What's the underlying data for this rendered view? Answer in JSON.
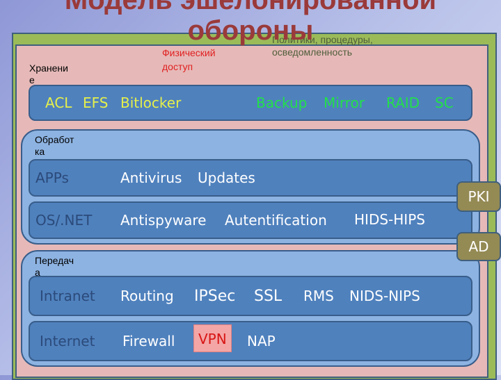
{
  "title": "Модель эшелонированной обороны",
  "labels": {
    "policies": "Политики, процедуры, осведомленность",
    "physical": "Физический доступ",
    "storage": "Хранение",
    "processing": "Обработка",
    "transfer": "Передача"
  },
  "storage_band": {
    "yellow_items": [
      "ACL",
      "EFS",
      "Bitlocker"
    ],
    "green_items": [
      "Backup",
      "Mirror",
      "RAID",
      "SC"
    ]
  },
  "processing": {
    "apps": {
      "name": "APPs",
      "items": [
        "Antivirus",
        "Updates"
      ]
    },
    "os": {
      "name": "OS/.NET",
      "items": [
        "Antispyware",
        "Autentification"
      ],
      "extra": "HIDS-HIPS"
    }
  },
  "transfer": {
    "intranet": {
      "name": "Intranet",
      "items": [
        "Routing",
        "IPSec",
        "SSL",
        "RMS",
        "NIDS-NIPS"
      ]
    },
    "internet": {
      "name": "Internet",
      "items": [
        "Firewall",
        "VPN",
        "NAP"
      ]
    }
  },
  "side_tags": {
    "pki": "PKI",
    "ad": "AD"
  },
  "colors": {
    "title": "#9a3a3a",
    "outer_frame": "#9bbb59",
    "inner_frame": "#e6b9b8",
    "group": "#8db3e2",
    "band": "#4f81bd",
    "tag": "#948a54",
    "highlight": "#f4a6a6"
  }
}
